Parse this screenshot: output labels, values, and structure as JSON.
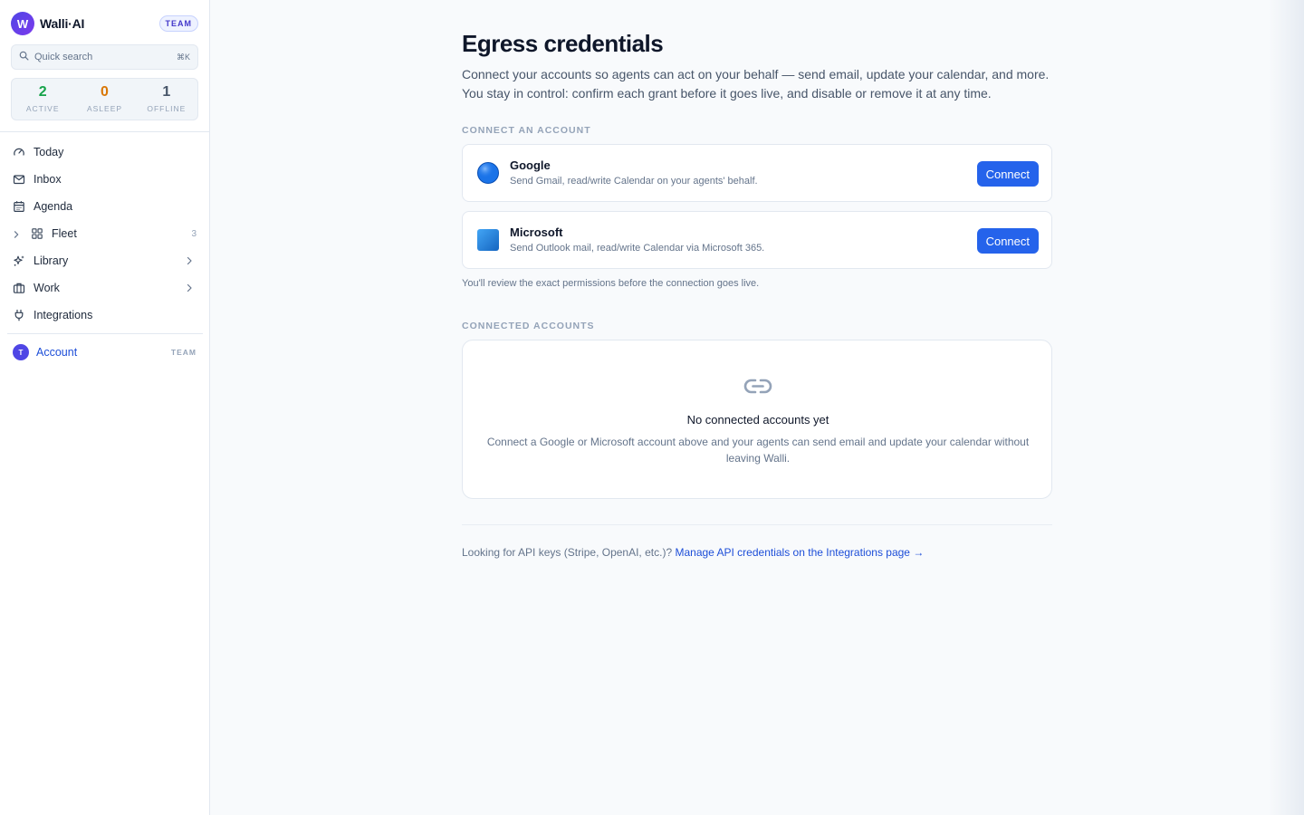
{
  "brand": {
    "logo_letter": "W",
    "name": "Walli·AI",
    "badge": "TEAM"
  },
  "search": {
    "placeholder": "Quick search",
    "shortcut": "⌘K"
  },
  "stats": [
    {
      "value": "2",
      "label": "ACTIVE",
      "color": "#16a34a"
    },
    {
      "value": "0",
      "label": "ASLEEP",
      "color": "#d97706"
    },
    {
      "value": "1",
      "label": "OFFLINE",
      "color": "#475569"
    }
  ],
  "nav": {
    "today": "Today",
    "inbox": "Inbox",
    "agenda": "Agenda",
    "fleet": "Fleet",
    "fleet_count": "3",
    "library": "Library",
    "work": "Work",
    "integrations": "Integrations"
  },
  "account": {
    "avatar_letter": "T",
    "label": "Account",
    "badge": "TEAM"
  },
  "page": {
    "title": "Egress credentials",
    "description_line1": "Connect your accounts so agents can act on your behalf — send email, update your calendar, and more.",
    "description_line2": "You stay in control: confirm each grant before it goes live, and disable or remove it at any time."
  },
  "connect_section": {
    "label": "CONNECT AN ACCOUNT",
    "providers": [
      {
        "icon": "google-icon",
        "name": "Google",
        "description": "Send Gmail, read/write Calendar on your agents' behalf.",
        "button": "Connect",
        "color": "#1a73e8"
      },
      {
        "icon": "microsoft-icon",
        "name": "Microsoft",
        "description": "Send Outlook mail, read/write Calendar via Microsoft 365.",
        "button": "Connect",
        "color": "#1e88e5"
      }
    ],
    "note": "You'll review the exact permissions before the connection goes live."
  },
  "connected_section": {
    "label": "CONNECTED ACCOUNTS",
    "empty_icon": "link-icon",
    "empty_title": "No connected accounts yet",
    "empty_description": "Connect a Google or Microsoft account above and your agents can send email and update your calendar without leaving Walli."
  },
  "footer": {
    "text": "Looking for API keys (Stripe, OpenAI, etc.)?",
    "link": "Manage API credentials on the Integrations page →"
  },
  "colors": {
    "accent": "#2563eb",
    "link": "#1d4ed8",
    "brand": "#4f46e5"
  }
}
